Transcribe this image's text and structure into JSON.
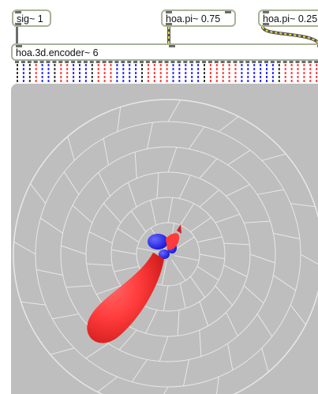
{
  "patcher": {
    "objects": {
      "sig": {
        "label": "sig~ 1"
      },
      "pi_a": {
        "label": "hoa.pi~ 0.75"
      },
      "pi_b": {
        "label": "hoa.pi~ 0.25"
      },
      "encoder": {
        "label": "hoa.3d.encoder~ 6"
      }
    },
    "encoder_outlets": 49
  },
  "colors": {
    "box_border": "#a7b29a",
    "scope_background": "#bebebe",
    "positive_lobe": "#ff3b3b",
    "negative_lobe": "#2a2aff",
    "signal_cord_stripe": "#f0de3a"
  }
}
